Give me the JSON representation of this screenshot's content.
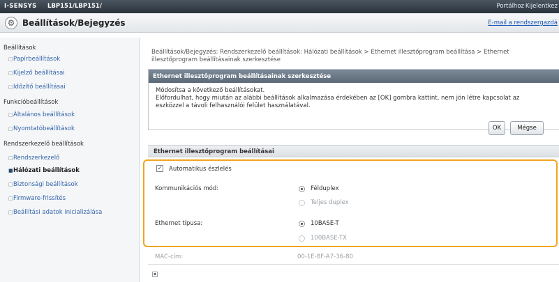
{
  "topbar": {
    "brand": "I-SENSYS",
    "model": "LBP151/LBP151/",
    "portal_link": "Portálhoz",
    "logout_link": "Kijelentkez"
  },
  "titlebar": {
    "icon": "gear-icon",
    "title": "Beállítások/Bejegyzés",
    "mail_link": "E-mail a rendszergazdá"
  },
  "sidebar": {
    "sections": [
      {
        "title": "Beállítások",
        "items": [
          {
            "label": "Papírbeállítások"
          },
          {
            "label": "Kijelző beállításai"
          },
          {
            "label": "Időzítő beállításai"
          }
        ]
      },
      {
        "title": "Funkcióbeállítások",
        "items": [
          {
            "label": "Általános beállítások"
          },
          {
            "label": "Nyomtatóbeállítások"
          }
        ]
      },
      {
        "title": "Rendszerkezelő beállítások",
        "items": [
          {
            "label": "Rendszerkezelő"
          },
          {
            "label": "Hálózati beállítások",
            "active": true
          },
          {
            "label": "Biztonsági beállítások"
          },
          {
            "label": "Firmware-frissítés"
          },
          {
            "label": "Beállítási adatok inicializálása"
          }
        ]
      }
    ]
  },
  "breadcrumb": {
    "line1": "Beállítások/Bejegyzés: Rendszerkezelő beállítások: Hálózati beállítások > Ethernet illesztőprogram beállítása > Ethernet",
    "line2": "illesztőprogram beállításainak szerkesztése"
  },
  "edit_panel": {
    "title": "Ethernet illesztőprogram beállításainak szerkesztése",
    "line1": "Módosítsa a következő beállításokat.",
    "line2": "Előfordulhat, hogy miután az alábbi beállítások alkalmazása érdekében az [OK] gombra kattint, nem jön létre kapcsolat az",
    "line3": "eszközzel a távoli felhasználói felület használatával.",
    "ok_label": "OK",
    "cancel_label": "Mégse"
  },
  "settings": {
    "section_title": "Ethernet illesztőprogram beállításai",
    "auto_detect_label": "Automatikus észlelés",
    "auto_detect_checked": true,
    "comm_mode_label": "Kommunikációs mód:",
    "comm_mode_options": [
      "Félduplex",
      "Teljes duplex"
    ],
    "comm_mode_selected": "Félduplex",
    "eth_type_label": "Ethernet típusa:",
    "eth_type_options": [
      "10BASE-T",
      "100BASE-TX"
    ],
    "eth_type_selected": "10BASE-T",
    "mac_label": "MAC-cím:",
    "mac_value": "00-1E-8F-A7-36-80"
  },
  "colors": {
    "highlight": "#f0a41e",
    "link": "#3564a8",
    "panel_header": "#5c6977"
  }
}
